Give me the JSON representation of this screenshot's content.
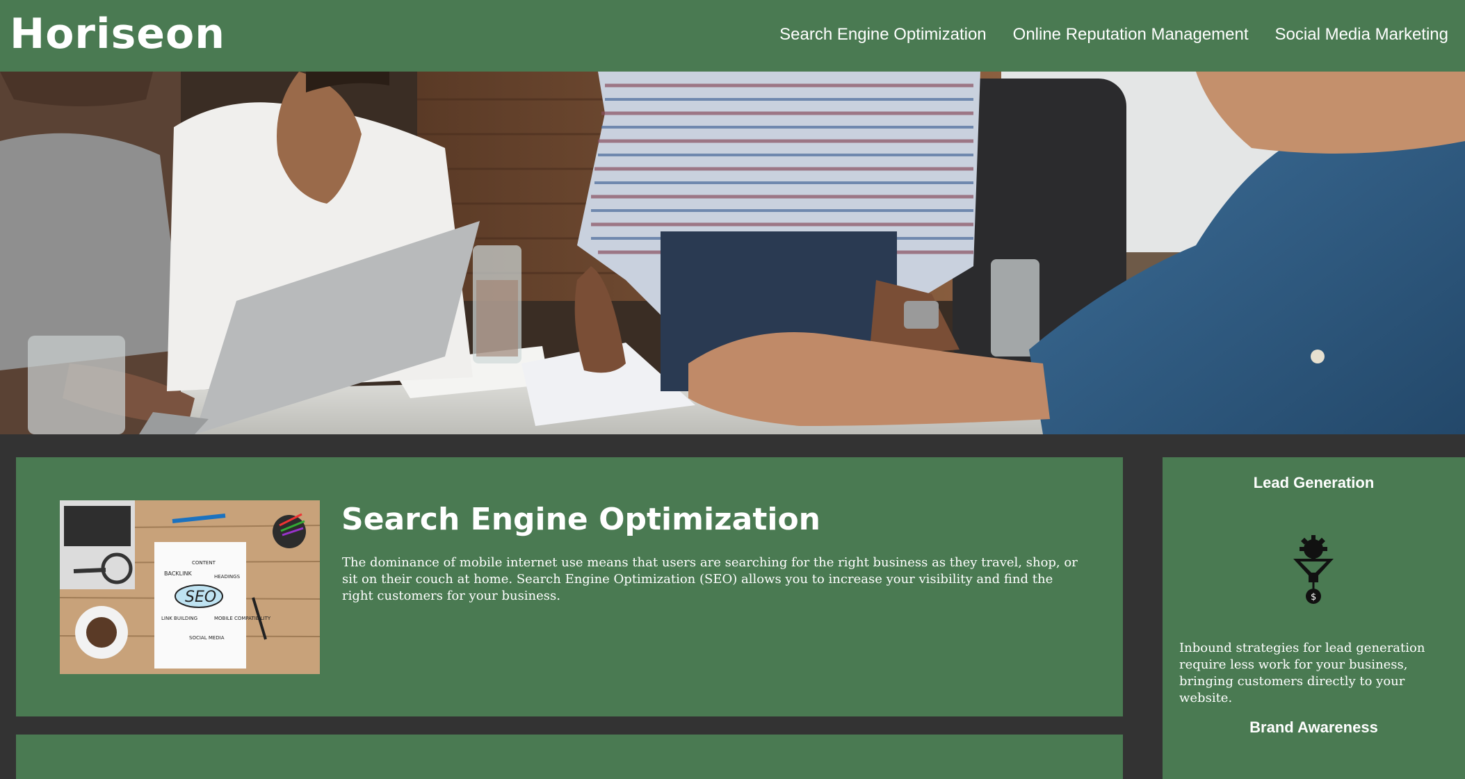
{
  "header": {
    "logo": "Horiseon",
    "nav": [
      {
        "label": "Search Engine Optimization"
      },
      {
        "label": "Online Reputation Management"
      },
      {
        "label": "Social Media Marketing"
      }
    ]
  },
  "main": {
    "seo": {
      "title": "Search Engine Optimization",
      "text": "The dominance of mobile internet use means that users are searching for the right business as they travel, shop, or sit on their couch at home. Search Engine Optimization (SEO) allows you to increase your visibility and find the right customers for your business.",
      "image_words": [
        "BACKLINK",
        "CONTENT",
        "HEADINGS",
        "SEO",
        "LINK BUILDING",
        "MOBILE COMPATIBILITY",
        "SOCIAL MEDIA"
      ]
    }
  },
  "sidebar": {
    "lead_title": "Lead Generation",
    "lead_text": "Inbound strategies for lead generation require less work for your business, bringing customers directly to your website.",
    "brand_title": "Brand Awareness"
  },
  "colors": {
    "brand_green": "#4a7a52",
    "background": "#333333",
    "text": "#ffffff"
  }
}
